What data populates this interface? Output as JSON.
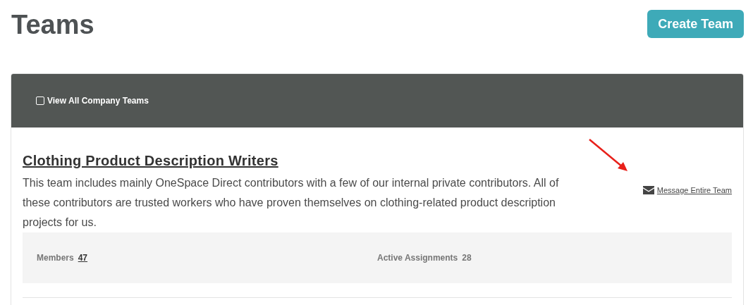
{
  "page": {
    "title": "Teams",
    "create_button": "Create Team"
  },
  "filter": {
    "label": "View All Company Teams",
    "checked": false
  },
  "teams": [
    {
      "name": "Clothing Product Description Writers",
      "description": "This team includes mainly OneSpace Direct contributors with a few of our internal private contributors. All of these contributors are trusted workers who have proven themselves on clothing-related product description projects for us.",
      "message_link": "Message Entire Team",
      "members_label": "Members",
      "members_count": "47",
      "assignments_label": "Active Assignments",
      "assignments_count": "28"
    }
  ]
}
